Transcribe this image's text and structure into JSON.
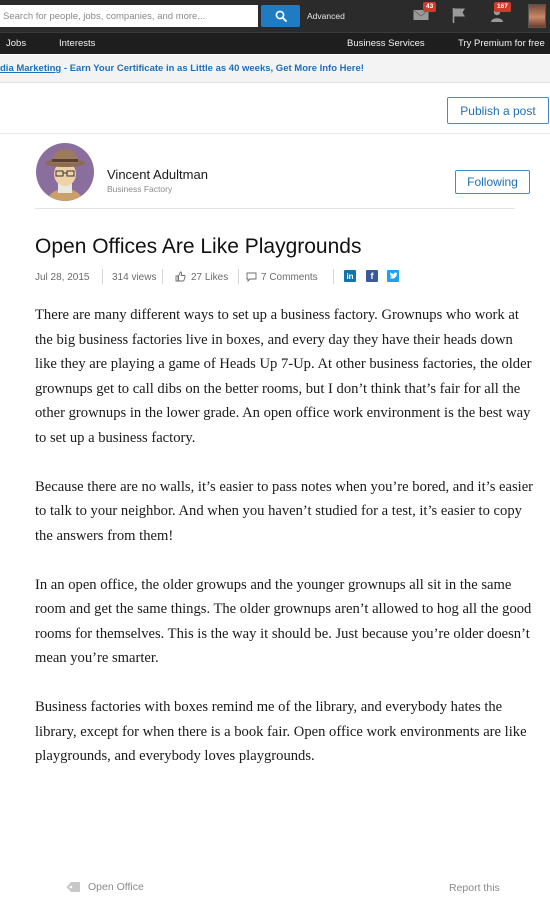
{
  "topbar": {
    "search_placeholder": "Search for people, jobs, companies, and more...",
    "advanced_label": "Advanced",
    "messages_count": "43",
    "notifications_count": "167"
  },
  "nav": {
    "items": [
      "Jobs",
      "Interests",
      "Business Services",
      "Try Premium for free"
    ]
  },
  "ad": {
    "link_text": "dia Marketing",
    "separator": " - ",
    "text": "Earn Your Certificate in as Little as 40 weeks, Get More Info Here!"
  },
  "actions": {
    "publish_label": "Publish a post",
    "following_label": "Following"
  },
  "author": {
    "name": "Vincent Adultman",
    "company": "Business Factory"
  },
  "post": {
    "title": "Open Offices Are Like Playgrounds",
    "date": "Jul 28, 2015",
    "views": "314 views",
    "likes": "27 Likes",
    "comments": "7 Comments",
    "paragraphs": [
      "There are many different ways to set up a business factory. Grownups who work at the big business factories live in boxes, and every day they have their heads down like they are playing a game of Heads Up 7-Up. At other business factories, the older grownups get to call dibs on the better rooms, but I don’t think that’s fair for all the other grownups in the lower grade. An open office work environment is the best way to set up a business factory.",
      "Because there are no walls, it’s easier to pass notes when you’re bored, and it’s easier to talk to your neighbor. And when you haven’t studied for a test, it’s easier to copy the answers from them!",
      "In an open office, the older growups and the younger grownups all sit in the same room and get the same things. The older grownups aren’t allowed to hog all the good rooms for themselves. This is the way it should be. Just because you’re older doesn’t mean you’re smarter.",
      "Business factories with boxes remind me of the library, and everybody hates the library, except for when there is a book fair. Open office work environments are like playgrounds, and everybody loves playgrounds."
    ]
  },
  "footer": {
    "tag_label": "Open Office",
    "report_label": "Report this"
  },
  "icons": {
    "search": "search-icon",
    "messages": "envelope-icon",
    "notifications": "flag-icon",
    "connections": "add-person-icon",
    "like": "thumbs-up-icon",
    "comment": "comment-icon",
    "tag": "tag-icon",
    "share": [
      "linkedin-icon",
      "facebook-icon",
      "twitter-icon"
    ]
  },
  "colors": {
    "accent": "#1f7bc2",
    "badge": "#d03b2e",
    "linkedin": "#0e76a8",
    "facebook": "#3b5998",
    "twitter": "#1da1f2"
  }
}
